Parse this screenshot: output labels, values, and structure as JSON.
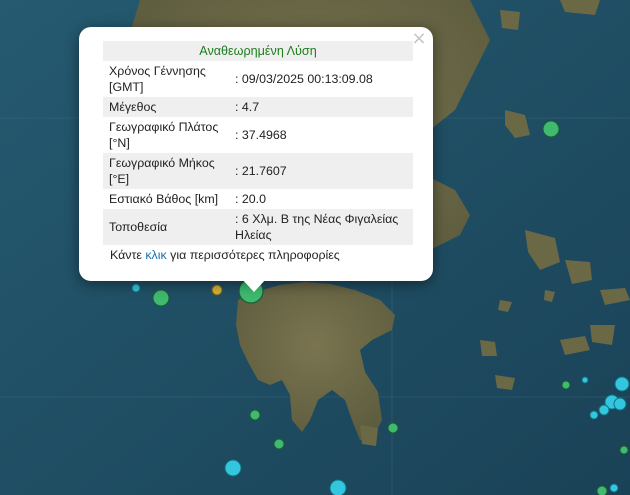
{
  "popup": {
    "title": "Αναθεωρημένη Λύση",
    "rows": [
      {
        "label": "Χρόνος Γέννησης [GMT]",
        "value": ": 09/03/2025 00:13:09.08"
      },
      {
        "label": "Μέγεθος",
        "value": ": 4.7"
      },
      {
        "label": "Γεωγραφικό Πλάτος [°N]",
        "value": ": 37.4968"
      },
      {
        "label": "Γεωγραφικό Μήκος [°E]",
        "value": ": 21.7607"
      },
      {
        "label": "Εστιακό Βάθος [km]",
        "value": ": 20.0"
      },
      {
        "label": "Τοποθεσία",
        "value": ": 6 Χλμ. Β της Νέας Φιγαλείας Ηλείας"
      }
    ],
    "more_prefix": "Κάντε",
    "more_link": "κλικ",
    "more_suffix": "για περισσότερες πληροφορίες",
    "close_icon": "×"
  },
  "colors": {
    "sea": "#1f4d62",
    "land": "#6e6a45",
    "marker_green": "#3fba6f",
    "marker_cyan": "#33c6df",
    "marker_yellow": "#d4b13a"
  }
}
